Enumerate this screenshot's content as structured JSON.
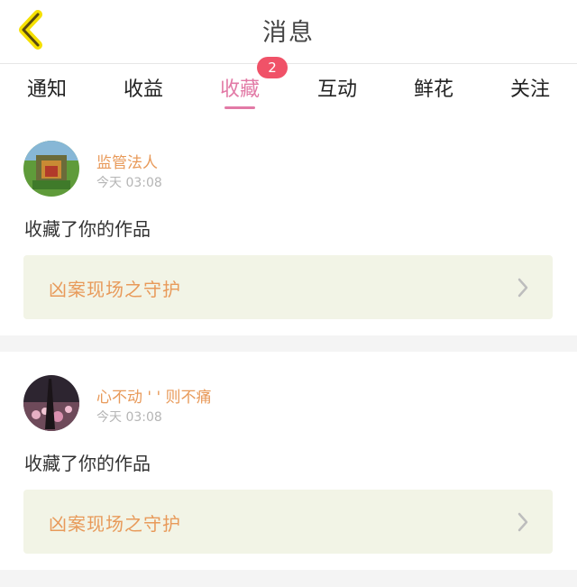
{
  "header": {
    "title": "消息"
  },
  "tabs": [
    {
      "label": "通知"
    },
    {
      "label": "收益"
    },
    {
      "label": "收藏",
      "active": true,
      "badge": "2"
    },
    {
      "label": "互动"
    },
    {
      "label": "鲜花"
    },
    {
      "label": "关注"
    }
  ],
  "messages": [
    {
      "user": "监管法人",
      "time": "今天 03:08",
      "action": "收藏了你的作品",
      "work": "凶案现场之守护"
    },
    {
      "user": "心不动 ' ' 则不痛",
      "time": "今天 03:08",
      "action": "收藏了你的作品",
      "work": "凶案现场之守护"
    }
  ],
  "colors": {
    "accent": "#e27aa6",
    "badge": "#f05268",
    "username": "#e89a5a",
    "card_bg": "#f2f4e6"
  },
  "icons": [
    "back-chevron-icon",
    "chevron-right-icon"
  ]
}
